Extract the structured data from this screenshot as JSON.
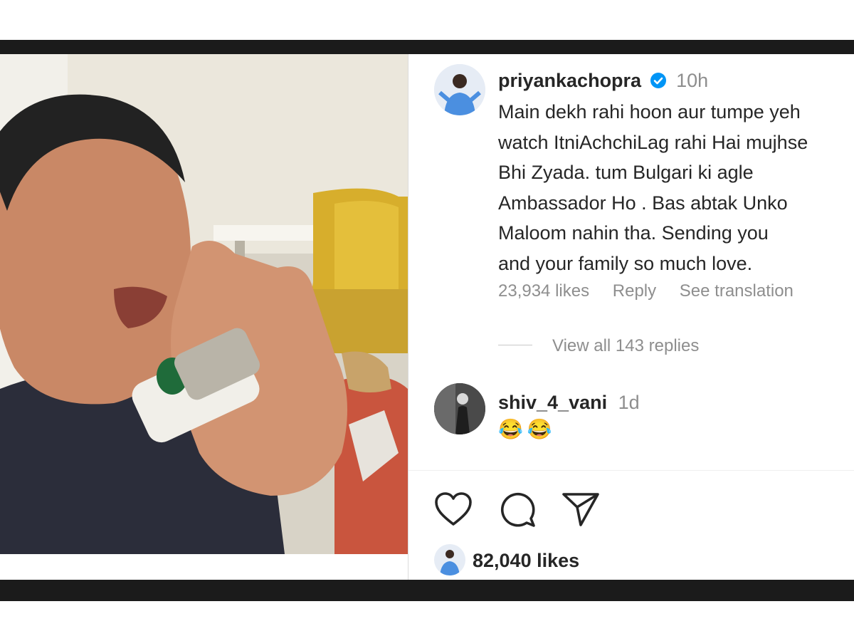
{
  "post": {
    "video_alt": "video frame",
    "actions": {
      "like_icon": "heart-icon",
      "comment_icon": "comment-icon",
      "share_icon": "send-icon"
    },
    "likes": "82,040 likes"
  },
  "comments": [
    {
      "username": "priyankachopra",
      "verified": true,
      "time": "10h",
      "text": "Main dekh rahi hoon aur tumpe yeh\nwatch ItniAchchiLag rahi Hai mujhse\nBhi Zyada. tum Bulgari ki agle\nAmbassador Ho . Bas abtak Unko\nMaloom nahin tha. Sending you\nand your family so much love.",
      "likes": "23,934 likes",
      "reply_label": "Reply",
      "translate_label": "See translation",
      "view_replies": "View all 143 replies"
    },
    {
      "username": "shiv_4_vani",
      "time": "1d",
      "text": "😂😂"
    }
  ],
  "colors": {
    "verified": "#0095f6",
    "text": "#262626",
    "muted": "#8e8e8e",
    "bar": "#1b1b1b"
  }
}
